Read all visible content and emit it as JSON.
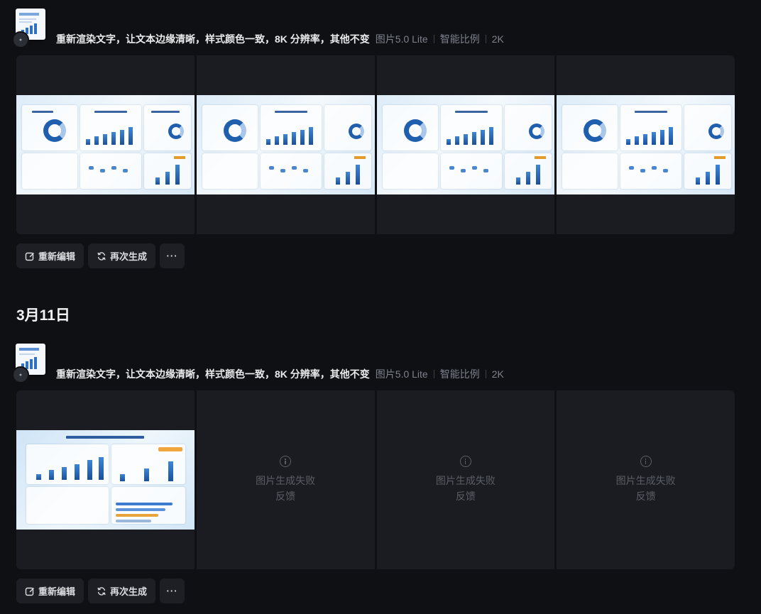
{
  "groups": [
    {
      "prompt": "重新渲染文字，让文本边缘清晰，样式颜色一致，8K 分辨率，其他不变",
      "model": "图片5.0 Lite",
      "ratio": "智能比例",
      "resolution": "2K",
      "results": [
        "image",
        "image",
        "image",
        "image"
      ],
      "actions": {
        "re_edit": "重新编辑",
        "regenerate": "再次生成",
        "more": "···"
      }
    },
    {
      "date": "3月11日",
      "prompt": "重新渲染文字，让文本边缘清晰，样式颜色一致，8K 分辨率，其他不变",
      "model": "图片5.0 Lite",
      "ratio": "智能比例",
      "resolution": "2K",
      "results": [
        "image",
        "failed",
        "failed",
        "failed"
      ],
      "failed_text": "图片生成失败",
      "feedback_text": "反馈",
      "actions": {
        "re_edit": "重新编辑",
        "regenerate": "再次生成",
        "more": "···"
      }
    }
  ],
  "icons": {
    "edit": "edit-icon",
    "regenerate": "refresh-icon",
    "info": "info-icon"
  },
  "colors": {
    "background": "#0f1013",
    "card": "#1b1c21",
    "button": "#1d1f24",
    "muted": "#7d828c"
  }
}
